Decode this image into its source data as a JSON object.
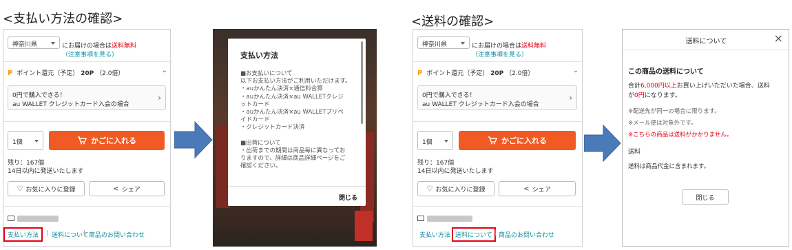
{
  "headings": {
    "payment": "<支払い方法の確認>",
    "shipping": "<送料の確認>"
  },
  "product_panel": {
    "prefecture": "神奈川県",
    "delivery_prefix": "にお届けの場合は",
    "delivery_free": "送料無料",
    "notes_link": "（注意事項を見る）",
    "point_mark": "P",
    "point_label": "ポイント還元（予定）",
    "point_value": "20P",
    "point_rate": "（2.0倍）",
    "card_line1": "0円で購入できる！",
    "card_line2": "au WALLET クレジットカード入会の場合",
    "qty": "1個",
    "cart_label": "かごに入れる",
    "stock": "残り：167個",
    "ship_days": "14日以内に発送いたします",
    "favorite_label": "お気に入りに登録",
    "share_label": "シェア",
    "payment_link": "支払い方法",
    "sep": "|",
    "shipping_link": "送料について",
    "inquiry_link": "商品のお問い合わせ"
  },
  "payment_modal": {
    "title": "支払い方法",
    "lines": [
      "■お支払いについて",
      "以下お支払い方法がご利用いただけます。",
      "・auかんたん決済×通信料合算",
      "・auかんたん決済×au WALLETクレジ",
      "ットカード",
      "・auかんたん決済×au WALLETプリペ",
      "イドカード",
      "・クレジットカード決済",
      "",
      "■出荷について",
      "・出荷までの期間は商品毎に異なってお",
      "りますので、詳細は商品詳細ページをご",
      "確認ください。"
    ],
    "close": "閉じる"
  },
  "shipping_modal": {
    "header": "送料について",
    "close_x": "×",
    "title": "この商品の送料について",
    "text1_pre": "合計",
    "text1_amount": "6,000円以上",
    "text1_post": "お買い上げいただいた場合、送料",
    "text2_pre": "が",
    "text2_red": "0円",
    "text2_post": "になります。",
    "note1": "※配送先が同一の場合に限ります。",
    "note2": "※メール便は対象外です。",
    "note3": "※こちらの商品は送料がかかりません。",
    "section": "送料",
    "section_text": "送料は商品代金に含まれます。",
    "close_button": "閉じる"
  },
  "colors": {
    "accent": "#f15a22",
    "highlight": "#e60012",
    "arrow": "#4a7ab8",
    "link": "#0a8ea0"
  }
}
